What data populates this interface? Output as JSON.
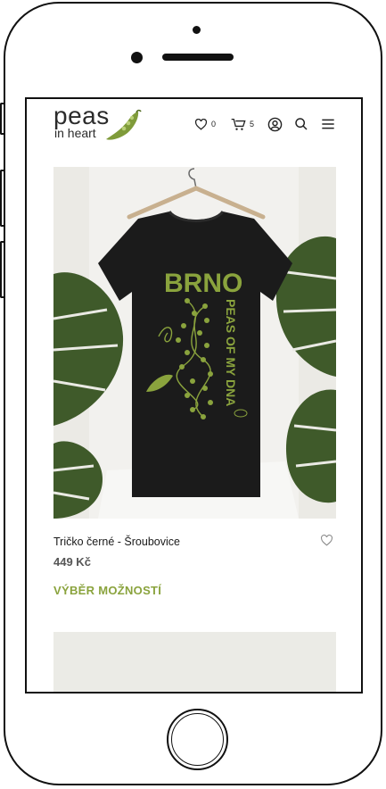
{
  "brand": {
    "name": "peas",
    "tagline": "in heart"
  },
  "header": {
    "wishlist_count": "0",
    "cart_count": "5"
  },
  "product": {
    "title": "Tričko černé - Šroubovice",
    "price": "449 Kč",
    "options_label": "VÝBĚR MOŽNOSTÍ",
    "print_top": "BRNO",
    "print_side": "PEAS OF MY DNA"
  },
  "colors": {
    "accent": "#8aa33d",
    "shirt": "#1a1a1a",
    "print": "#8aa33d"
  }
}
